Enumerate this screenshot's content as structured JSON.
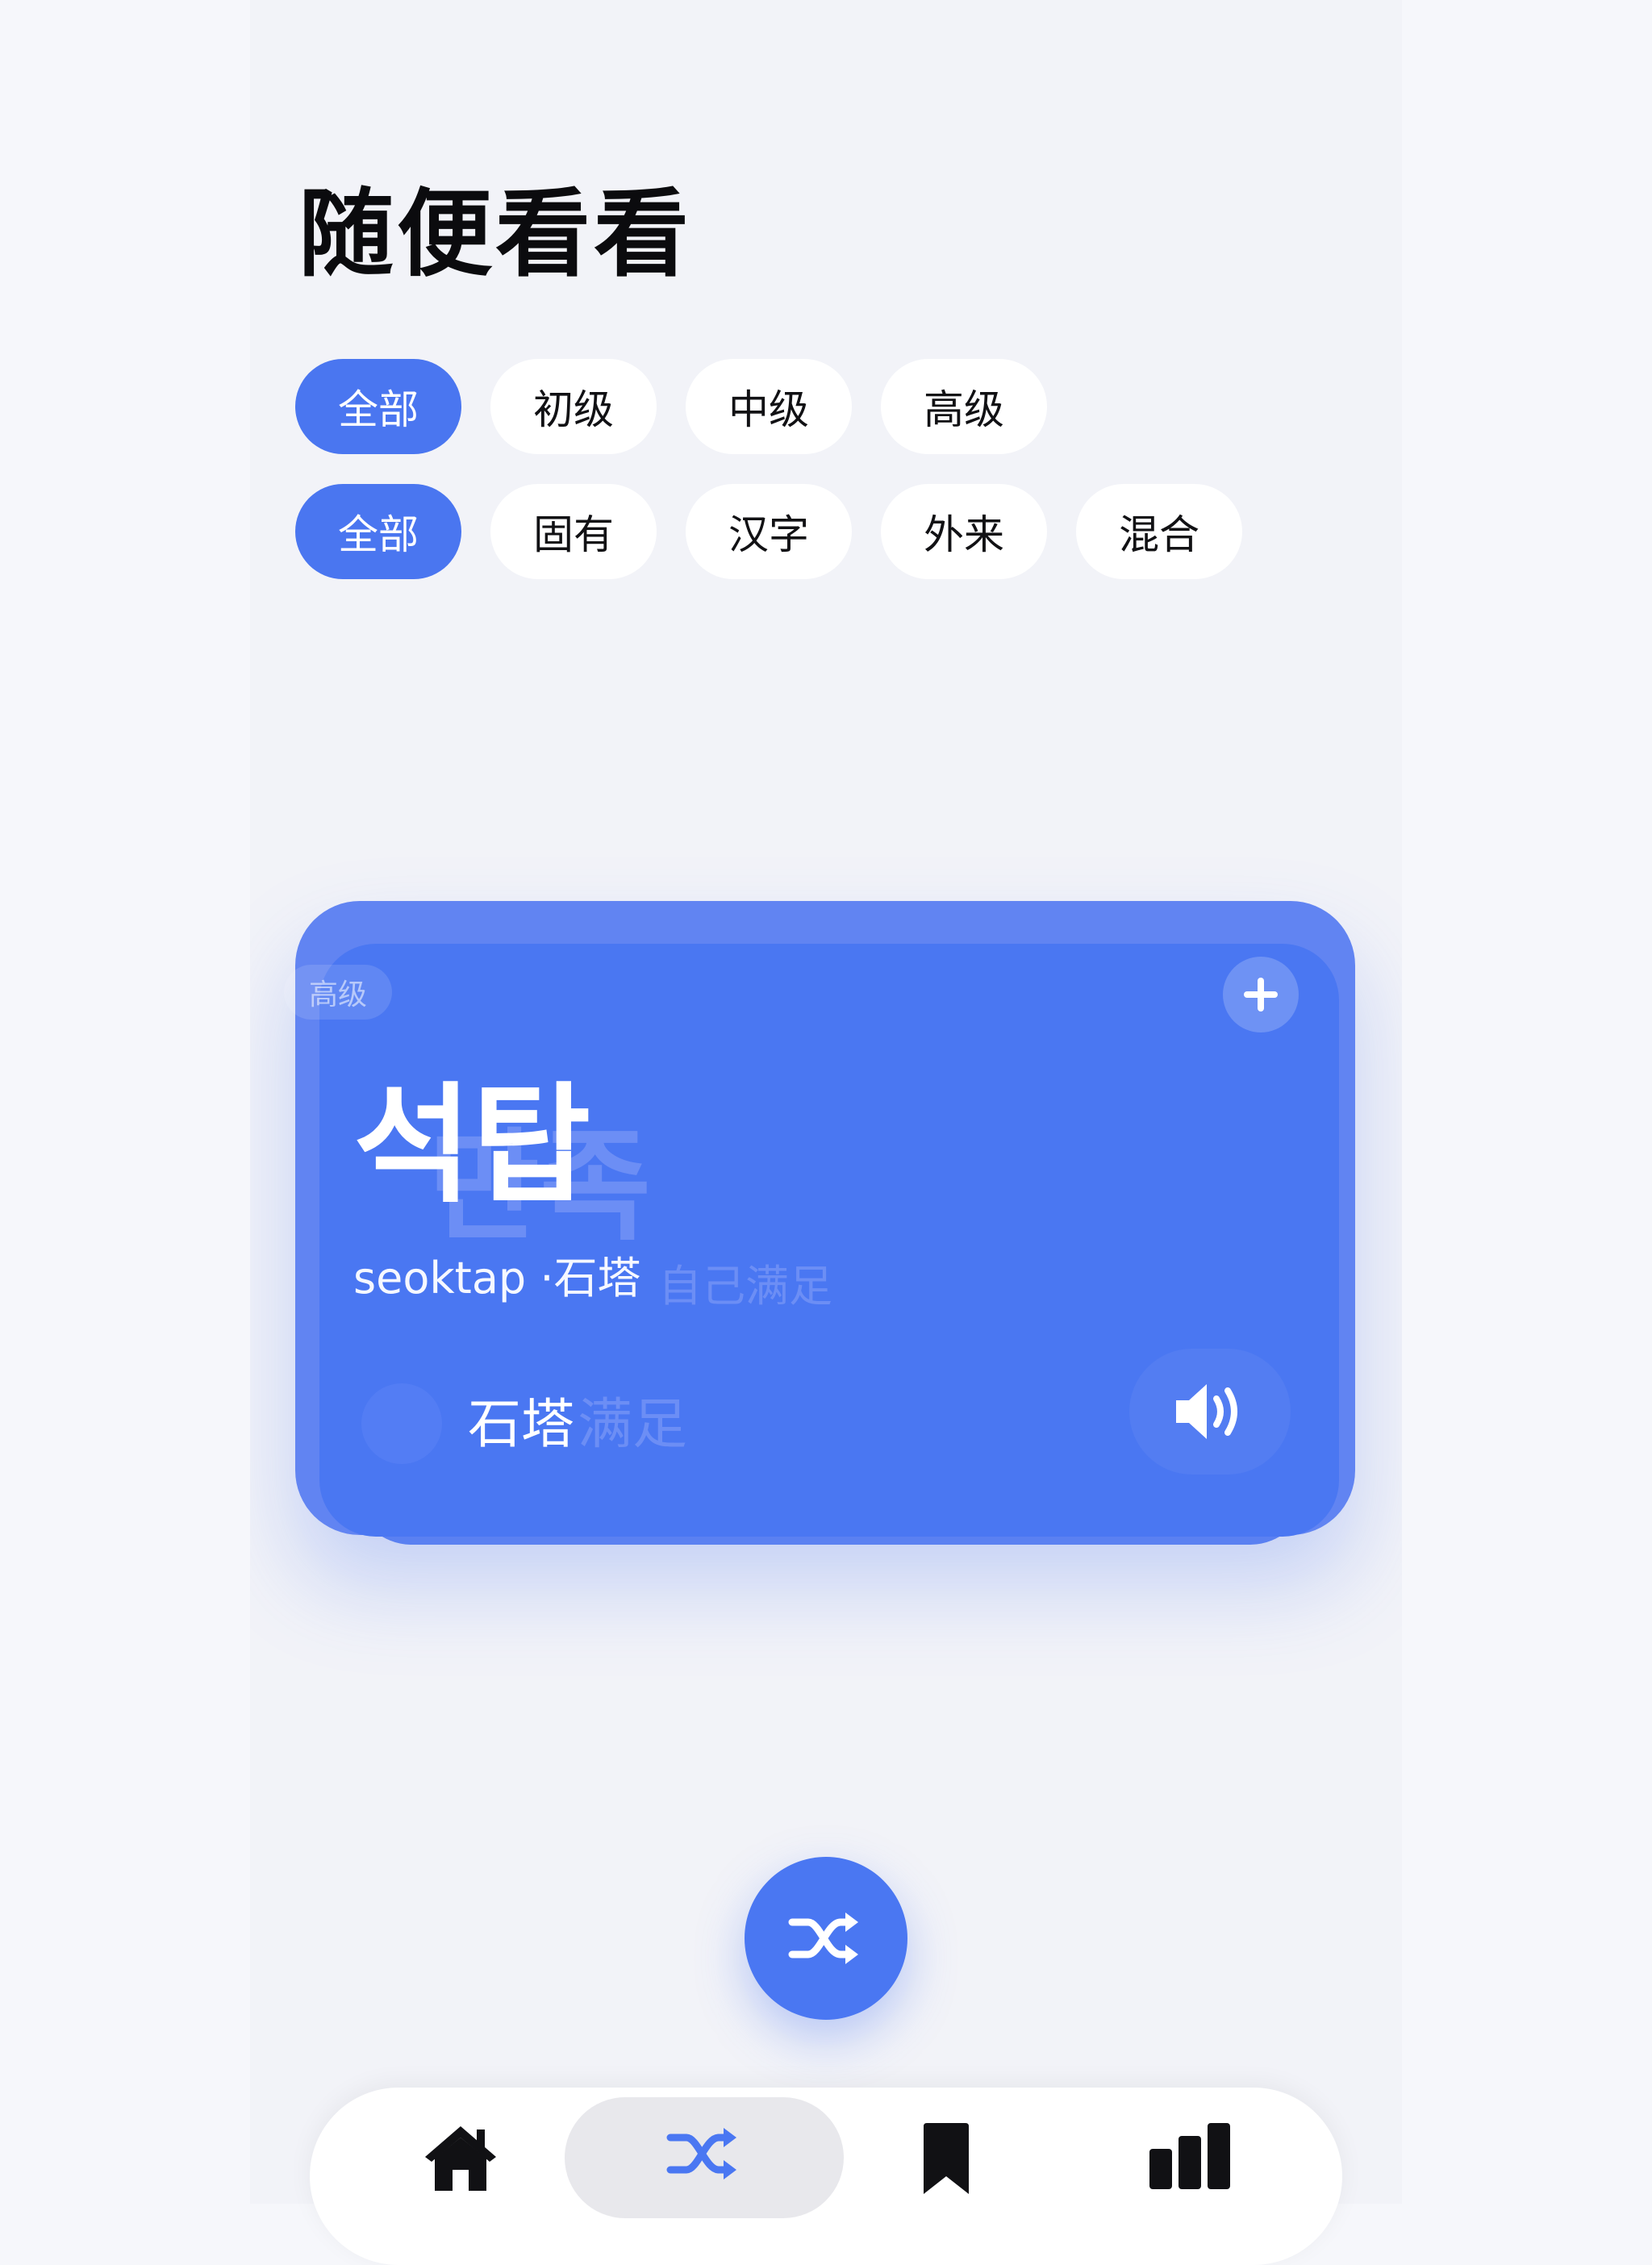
{
  "page": {
    "title": "随便看看"
  },
  "filters": {
    "level": [
      {
        "label": "全部",
        "active": true
      },
      {
        "label": "初级",
        "active": false
      },
      {
        "label": "中级",
        "active": false
      },
      {
        "label": "高级",
        "active": false
      }
    ],
    "origin": [
      {
        "label": "全部",
        "active": true
      },
      {
        "label": "固有",
        "active": false
      },
      {
        "label": "汉字",
        "active": false
      },
      {
        "label": "外来",
        "active": false
      },
      {
        "label": "混合",
        "active": false
      }
    ]
  },
  "card": {
    "level": "高级",
    "word": "석탑",
    "romanization": "seoktap",
    "hanja": "石塔",
    "meaning": "石塔",
    "add_icon": "plus-icon",
    "speaker_icon": "speaker-icon"
  },
  "background_card": {
    "word": "만족",
    "subtitle": "自己满足",
    "meaning": "满足"
  },
  "fab": {
    "icon": "shuffle-icon"
  },
  "tab_bar": {
    "items": [
      {
        "icon": "home-icon",
        "active": false
      },
      {
        "icon": "shuffle-icon",
        "active": true
      },
      {
        "icon": "bookmark-icon",
        "active": false
      },
      {
        "icon": "chart-bar-icon",
        "active": false
      }
    ]
  },
  "colors": {
    "accent": "#4a77f2",
    "background": "#f2f3f8",
    "chip_inactive": "#ffffff",
    "title_text": "#0b0b0e"
  }
}
